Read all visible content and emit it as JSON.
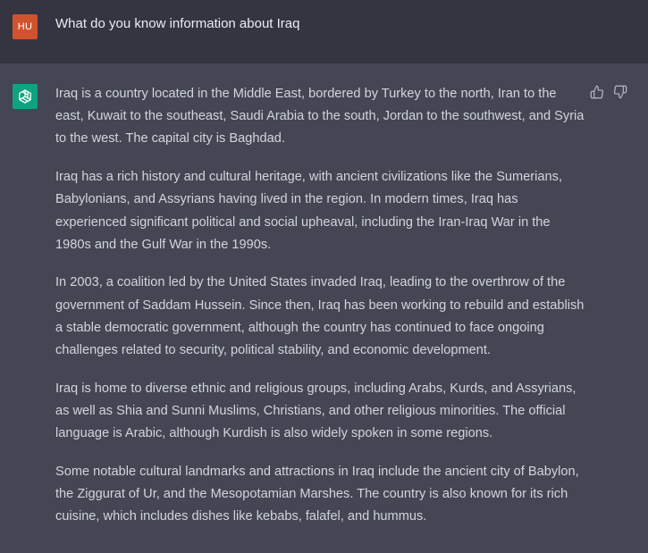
{
  "user_message": {
    "avatar_initials": "HU",
    "text": "What do you know information about Iraq"
  },
  "assistant_message": {
    "avatar_icon": "openai-logo-icon",
    "paragraphs": [
      "Iraq is a country located in the Middle East, bordered by Turkey to the north, Iran to the east, Kuwait to the southeast, Saudi Arabia to the south, Jordan to the southwest, and Syria to the west. The capital city is Baghdad.",
      "Iraq has a rich history and cultural heritage, with ancient civilizations like the Sumerians, Babylonians, and Assyrians having lived in the region. In modern times, Iraq has experienced significant political and social upheaval, including the Iran-Iraq War in the 1980s and the Gulf War in the 1990s.",
      "In 2003, a coalition led by the United States invaded Iraq, leading to the overthrow of the government of Saddam Hussein. Since then, Iraq has been working to rebuild and establish a stable democratic government, although the country has continued to face ongoing challenges related to security, political stability, and economic development.",
      "Iraq is home to diverse ethnic and religious groups, including Arabs, Kurds, and Assyrians, as well as Shia and Sunni Muslims, Christians, and other religious minorities. The official language is Arabic, although Kurdish is also widely spoken in some regions.",
      "Some notable cultural landmarks and attractions in Iraq include the ancient city of Babylon, the Ziggurat of Ur, and the Mesopotamian Marshes. The country is also known for its rich cuisine, which includes dishes like kebabs, falafel, and hummus."
    ],
    "feedback_icons": [
      "thumbs-up-icon",
      "thumbs-down-icon"
    ]
  },
  "colors": {
    "user_bg": "#343541",
    "assistant_bg": "#444654",
    "user_avatar": "#d0532e",
    "bot_avatar": "#10a37f",
    "text": "#d1d5db"
  }
}
